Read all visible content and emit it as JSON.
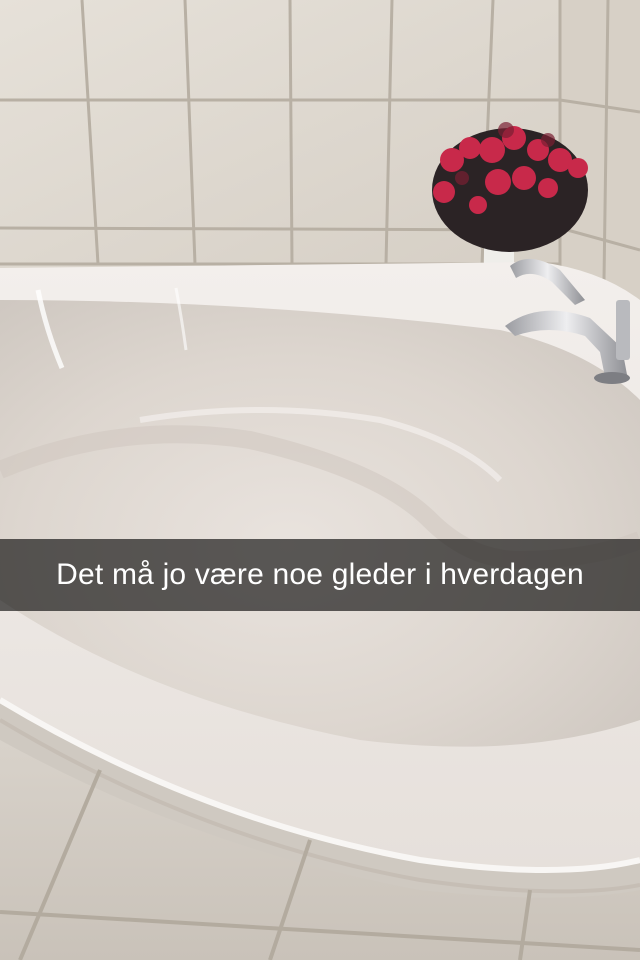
{
  "snap": {
    "caption": "Det må jo være noe gleder i hverdagen"
  },
  "scene": {
    "objects": [
      "tiled-wall",
      "corner-bathtub",
      "faucet",
      "flower-pot",
      "floor-tiles"
    ],
    "colors": {
      "wall_tile": "#dcd6cd",
      "grout": "#b9b1a5",
      "tub": "#ece7e2",
      "flowers": "#c8294a",
      "leaves": "#2b2325",
      "chrome": "#c9c9cc"
    }
  }
}
